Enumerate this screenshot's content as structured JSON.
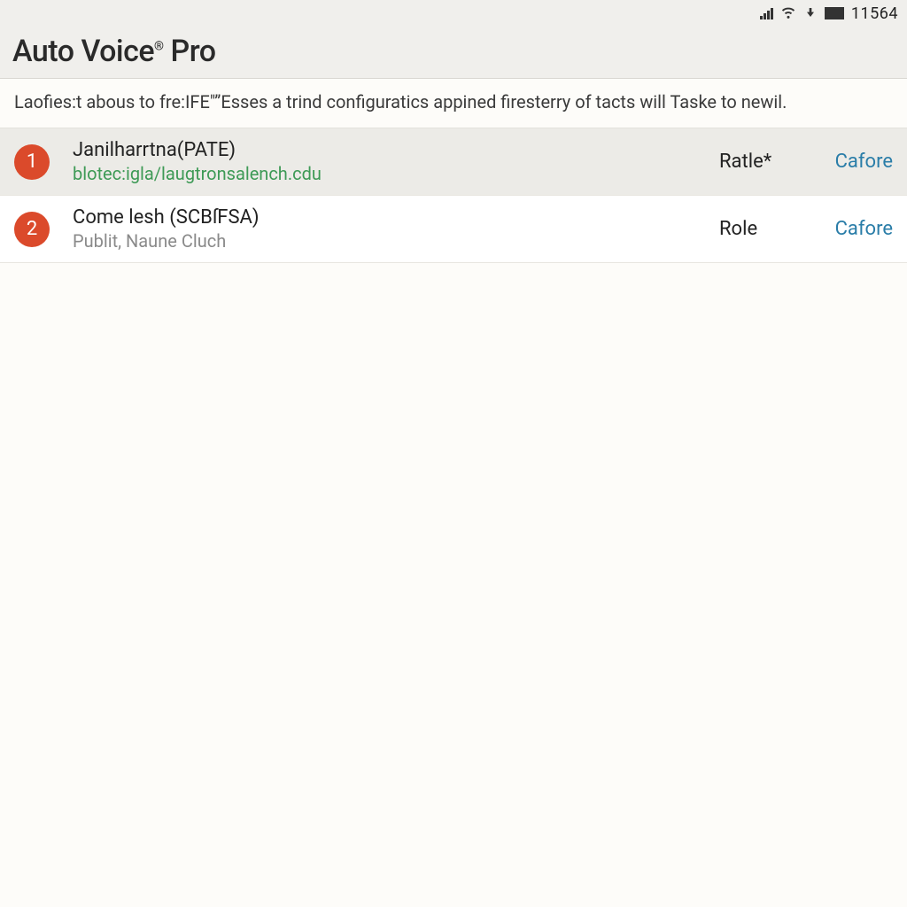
{
  "status_bar": {
    "left_text": "",
    "time": "11564"
  },
  "header": {
    "title_pre": "Auto Voice",
    "title_sup": "®",
    "title_post": " Pro"
  },
  "description": "Laofies:t abous to fre:IFE\"”Esses a trind configuratics appined firesterry of tacts will Taske to newil.",
  "rows": [
    {
      "num": "1",
      "title": "Janilharrtna(PATE)",
      "sub": "blotec:igla/laugtronsalench.cdu",
      "sub_style": "link",
      "role": "Ratle*",
      "action": "Cafore"
    },
    {
      "num": "2",
      "title": "Come lesh (SCBſFSA)",
      "sub": "Publit, Naune Cluch",
      "sub_style": "muted",
      "role": "Role",
      "action": "Cafore"
    }
  ]
}
